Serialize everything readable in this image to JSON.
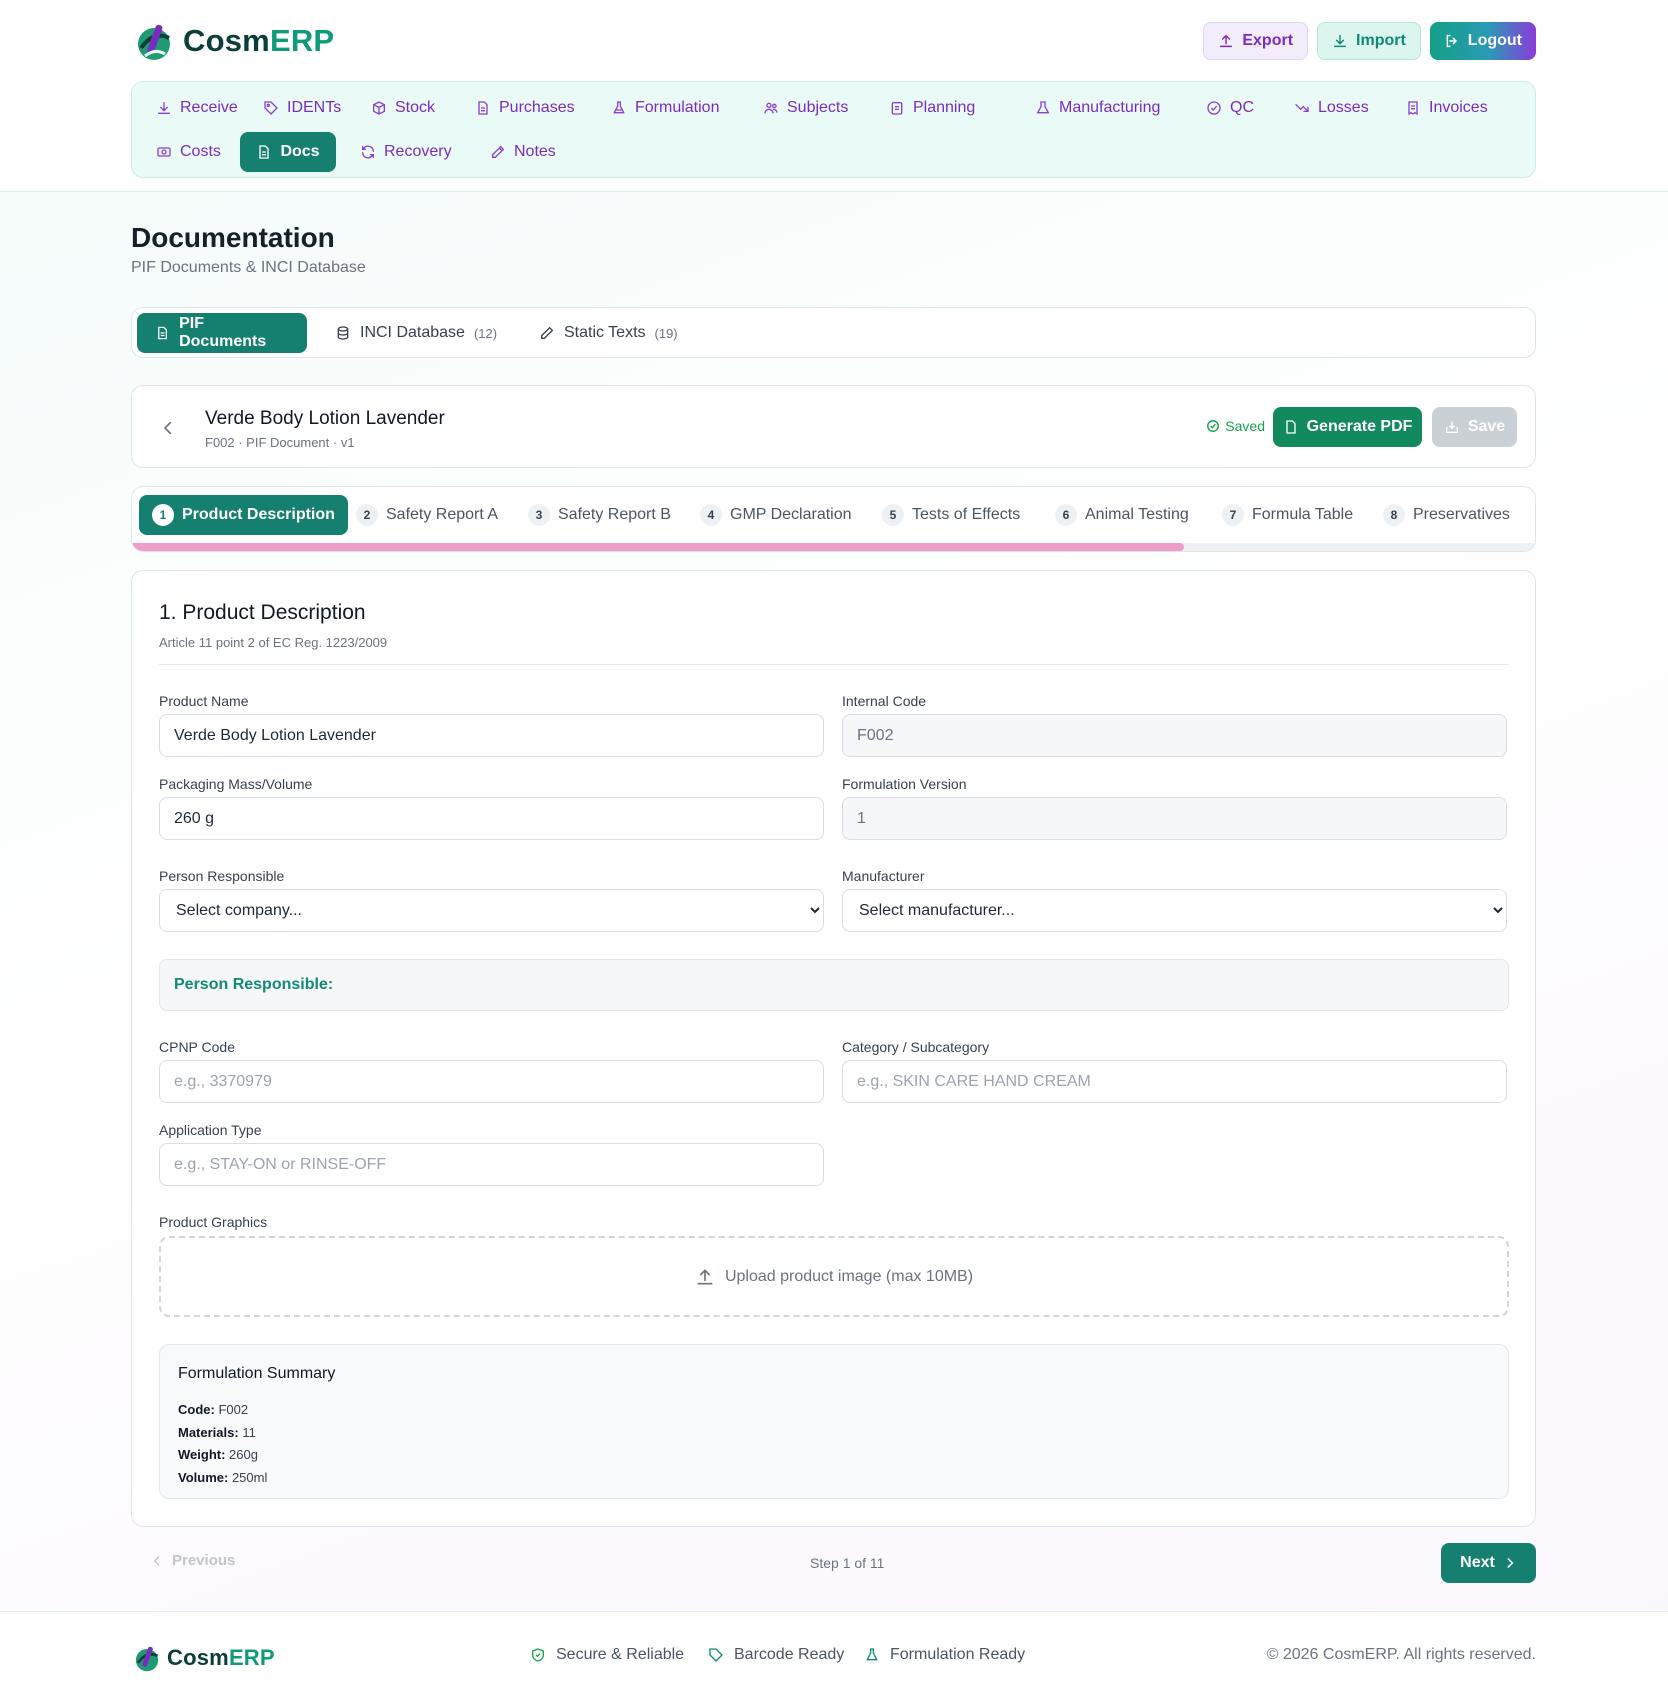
{
  "brand": {
    "name_part1": "Cosm",
    "name_part2": "ERP"
  },
  "header_buttons": {
    "export": "Export",
    "import": "Import",
    "logout": "Logout"
  },
  "nav": [
    {
      "label": "Receive",
      "icon": "download-icon"
    },
    {
      "label": "IDENTs",
      "icon": "tag-icon"
    },
    {
      "label": "Stock",
      "icon": "box-icon"
    },
    {
      "label": "Purchases",
      "icon": "file-icon"
    },
    {
      "label": "Formulation",
      "icon": "flask-icon"
    },
    {
      "label": "Subjects",
      "icon": "users-icon"
    },
    {
      "label": "Planning",
      "icon": "clipboard-icon"
    },
    {
      "label": "Manufacturing",
      "icon": "beaker-icon"
    },
    {
      "label": "QC",
      "icon": "check-circle-icon"
    },
    {
      "label": "Losses",
      "icon": "trending-down-icon"
    },
    {
      "label": "Invoices",
      "icon": "receipt-icon"
    },
    {
      "label": "Costs",
      "icon": "coins-icon"
    },
    {
      "label": "Docs",
      "icon": "document-icon",
      "active": true
    },
    {
      "label": "Recovery",
      "icon": "refresh-icon"
    },
    {
      "label": "Notes",
      "icon": "edit-icon"
    }
  ],
  "page": {
    "title": "Documentation",
    "subtitle": "PIF Documents & INCI Database"
  },
  "tabs": [
    {
      "label": "PIF Documents",
      "count": ""
    },
    {
      "label": "INCI Database",
      "count": "(12)"
    },
    {
      "label": "Static Texts",
      "count": "(19)"
    }
  ],
  "document": {
    "title": "Verde Body Lotion Lavender",
    "subtitle": "F002 · PIF Document · v1",
    "saved_label": "Saved",
    "generate_pdf": "Generate PDF",
    "save": "Save"
  },
  "steps": [
    {
      "num": "1",
      "label": "Product Description"
    },
    {
      "num": "2",
      "label": "Safety Report A"
    },
    {
      "num": "3",
      "label": "Safety Report B"
    },
    {
      "num": "4",
      "label": "GMP Declaration"
    },
    {
      "num": "5",
      "label": "Tests of Effects"
    },
    {
      "num": "6",
      "label": "Animal Testing"
    },
    {
      "num": "7",
      "label": "Formula Table"
    },
    {
      "num": "8",
      "label": "Preservatives"
    }
  ],
  "progress_fraction": 0.75,
  "form": {
    "section_title": "1. Product Description",
    "section_subtitle": "Article 11 point 2 of EC Reg. 1223/2009",
    "product_name_label": "Product Name",
    "product_name_value": "Verde Body Lotion Lavender",
    "internal_code_label": "Internal Code",
    "internal_code_value": "F002",
    "packaging_label": "Packaging Mass/Volume",
    "packaging_value": "260 g",
    "formulation_version_label": "Formulation Version",
    "formulation_version_value": "1",
    "person_responsible_label": "Person Responsible",
    "person_responsible_selected": "Select company...",
    "manufacturer_label": "Manufacturer",
    "manufacturer_selected": "Select manufacturer...",
    "person_responsible_box": "Person Responsible:",
    "cpnp_label": "CPNP Code",
    "cpnp_placeholder": "e.g., 3370979",
    "category_label": "Category / Subcategory",
    "category_placeholder": "e.g., SKIN CARE HAND CREAM",
    "application_label": "Application Type",
    "application_placeholder": "e.g., STAY-ON or RINSE-OFF",
    "graphics_label": "Product Graphics",
    "upload_text": "Upload product image (max 10MB)"
  },
  "summary": {
    "title": "Formulation Summary",
    "code_label": "Code:",
    "code_value": " F002",
    "materials_label": "Materials:",
    "materials_value": " 11",
    "weight_label": "Weight:",
    "weight_value": " 260g",
    "volume_label": "Volume:",
    "volume_value": " 250ml"
  },
  "pager": {
    "previous": "Previous",
    "step_text": "Step 1 of 11",
    "next": "Next"
  },
  "footer": {
    "features": [
      "Secure & Reliable",
      "Barcode Ready",
      "Formulation Ready"
    ],
    "copyright": "© 2026 CosmERP. All rights reserved."
  },
  "colors": {
    "primary": "#157f70",
    "accent_purple": "#7b2cbf",
    "progress": "#ec9ec8",
    "saved_green": "#16a34a"
  }
}
